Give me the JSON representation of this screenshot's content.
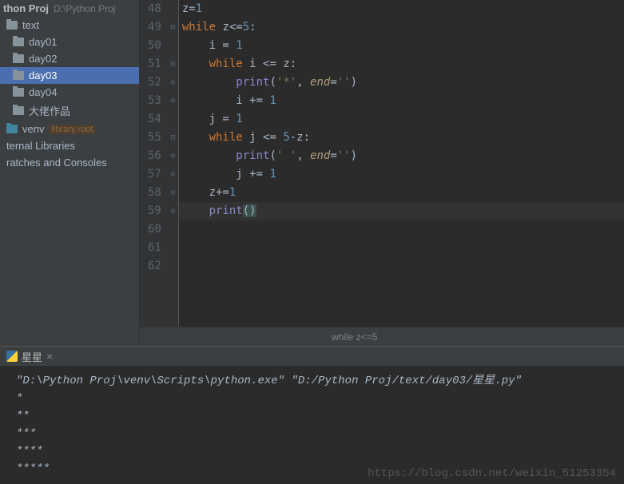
{
  "project": {
    "name": "thon Proj",
    "path": "D:\\Python Proj"
  },
  "tree": {
    "text_dir": "text",
    "items": [
      "day01",
      "day02",
      "day03",
      "day04",
      "大佬作品"
    ],
    "selected": "day03",
    "venv": "venv",
    "lib_root": "library root",
    "ext_lib": "ternal Libraries",
    "scratches": "ratches and Consoles"
  },
  "gutter": {
    "start": 48,
    "end": 62
  },
  "code": {
    "l48_a": "z=",
    "l48_b": "1",
    "l49_a": "while",
    "l49_b": " z<=",
    "l49_c": "5",
    "l49_d": ":",
    "l50_a": "i = ",
    "l50_b": "1",
    "l51_a": "while",
    "l51_b": " i <= z:",
    "l52_a": "print",
    "l52_b": "(",
    "l52_c": "'*'",
    "l52_d": ", ",
    "l52_e": "end",
    "l52_f": "=",
    "l52_g": "''",
    "l52_h": ")",
    "l53_a": "i += ",
    "l53_b": "1",
    "l54_a": "j = ",
    "l54_b": "1",
    "l55_a": "while",
    "l55_b": " j <= ",
    "l55_c": "5",
    "l55_d": "-z:",
    "l56_a": "print",
    "l56_b": "(",
    "l56_c": "' '",
    "l56_d": ", ",
    "l56_e": "end",
    "l56_f": "=",
    "l56_g": "''",
    "l56_h": ")",
    "l57_a": "j += ",
    "l57_b": "1",
    "l58_a": "z+=",
    "l58_b": "1",
    "l59_a": "print",
    "l59_b": "(",
    "l59_c": ")"
  },
  "breadcrumb": "while z<=5",
  "console": {
    "tab": "星星",
    "cmd": "\"D:\\Python Proj\\venv\\Scripts\\python.exe\" \"D:/Python Proj/text/day03/星星.py\"",
    "out": [
      "*",
      "**",
      "***",
      "****",
      "*****"
    ]
  },
  "watermark": "https://blog.csdn.net/weixin_51253354"
}
